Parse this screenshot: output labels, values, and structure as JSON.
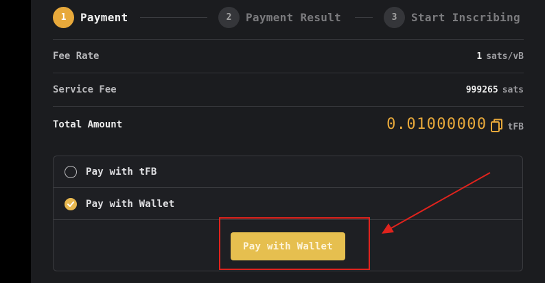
{
  "stepper": {
    "steps": [
      {
        "number": "1",
        "label": "Payment",
        "active": true
      },
      {
        "number": "2",
        "label": "Payment Result",
        "active": false
      },
      {
        "number": "3",
        "label": "Start Inscribing",
        "active": false
      }
    ]
  },
  "fees": {
    "fee_rate": {
      "label": "Fee Rate",
      "value": "1",
      "unit": "sats/vB"
    },
    "service_fee": {
      "label": "Service Fee",
      "value": "999265",
      "unit": "sats"
    },
    "total": {
      "label": "Total Amount",
      "value": "0.01000000",
      "unit": "tFB"
    }
  },
  "payment_options": [
    {
      "label": "Pay with tFB",
      "checked": false
    },
    {
      "label": "Pay with Wallet",
      "checked": true
    }
  ],
  "pay_button": {
    "label": "Pay with Wallet"
  },
  "colors": {
    "accent": "#e8a93b",
    "button": "#e6bf4f",
    "annotation": "#e0231d"
  }
}
